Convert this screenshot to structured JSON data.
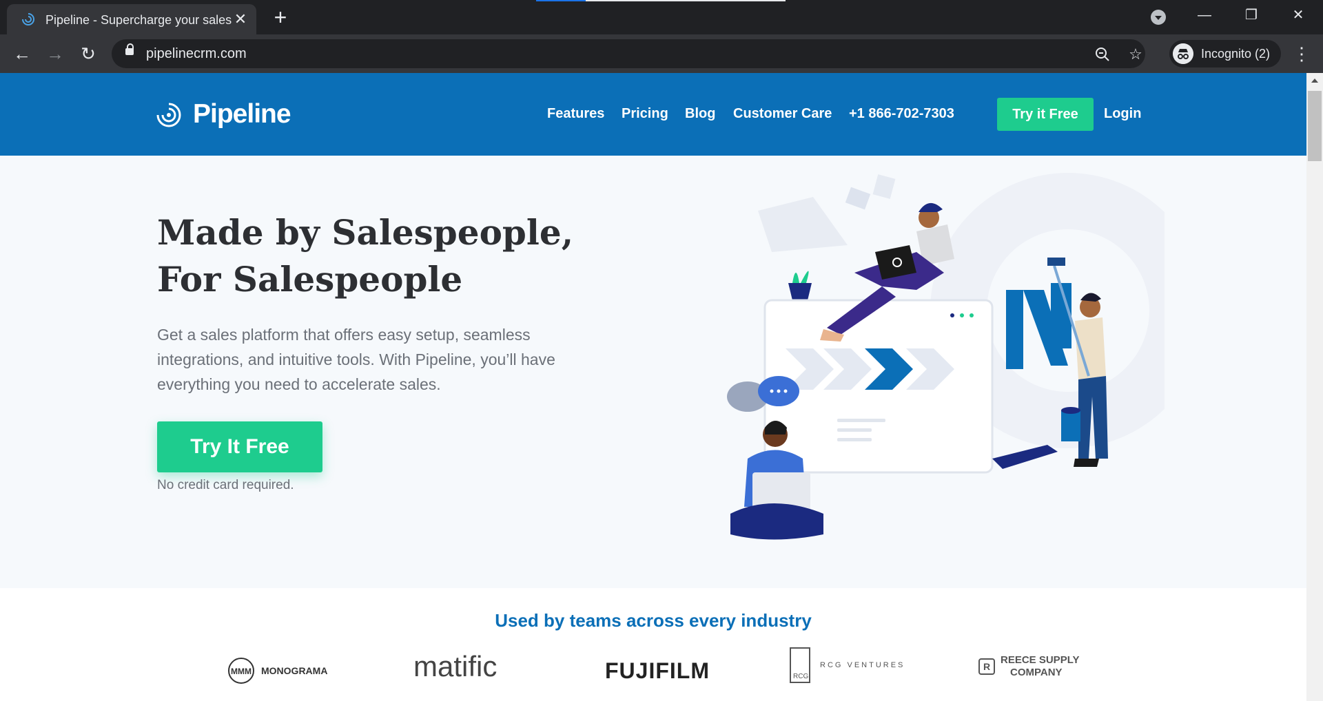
{
  "browser": {
    "tab_title": "Pipeline - Supercharge your sales",
    "url": "pipelinecrm.com",
    "profile_label": "Incognito (2)"
  },
  "header": {
    "logo_text": "Pipeline",
    "nav": {
      "features": "Features",
      "pricing": "Pricing",
      "blog": "Blog",
      "customer_care": "Customer Care",
      "phone": "+1 866-702-7303",
      "try_free": "Try it Free",
      "login": "Login"
    }
  },
  "hero": {
    "title_line1": "Made by Salespeople,",
    "title_line2": "For Salespeople",
    "description": "Get a sales platform that offers easy setup, seamless integrations, and intuitive tools. With Pipeline, you’ll have everything you need to accelerate sales.",
    "cta": "Try It Free",
    "note": "No credit card required."
  },
  "logos": {
    "title": "Used by teams across every industry",
    "brands": {
      "monograma": "MONOGRAMA",
      "matific": "matific",
      "fujifilm": "FUJIFILM",
      "rcg_mark": "RCG",
      "rcg": "RCG VENTURES",
      "reece_line1": "REECE SUPPLY",
      "reece_line2": "COMPANY"
    }
  },
  "colors": {
    "header_blue": "#0b6fb7",
    "accent_green": "#1ecc8e",
    "hero_bg": "#f6f9fc"
  }
}
